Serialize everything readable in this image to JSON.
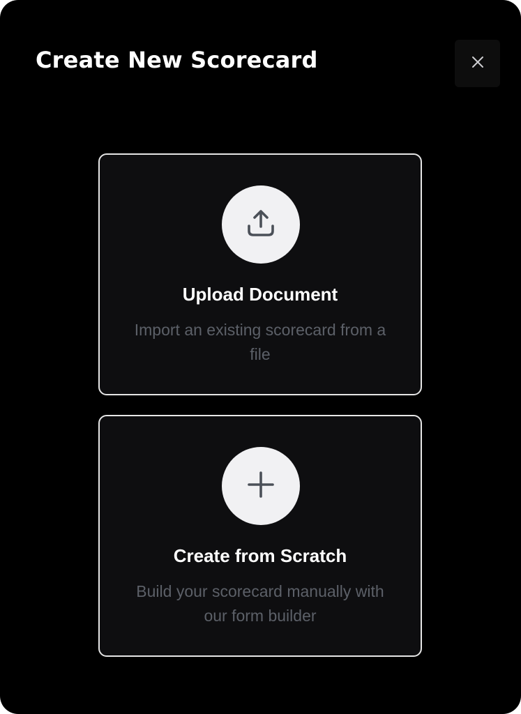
{
  "dialog": {
    "title": "Create New Scorecard",
    "close_icon": "close-icon"
  },
  "options": {
    "upload": {
      "icon": "upload-icon",
      "title": "Upload Document",
      "description": "Import an existing scorecard from a file"
    },
    "scratch": {
      "icon": "plus-icon",
      "title": "Create from Scratch",
      "description": "Build your scorecard manually with our form builder"
    }
  },
  "colors": {
    "background": "#000000",
    "card_background": "#0e0e10",
    "card_border": "#e6e6e6",
    "icon_circle": "#f1f1f3",
    "icon_stroke": "#4b5058",
    "description_text": "#5c6068"
  }
}
